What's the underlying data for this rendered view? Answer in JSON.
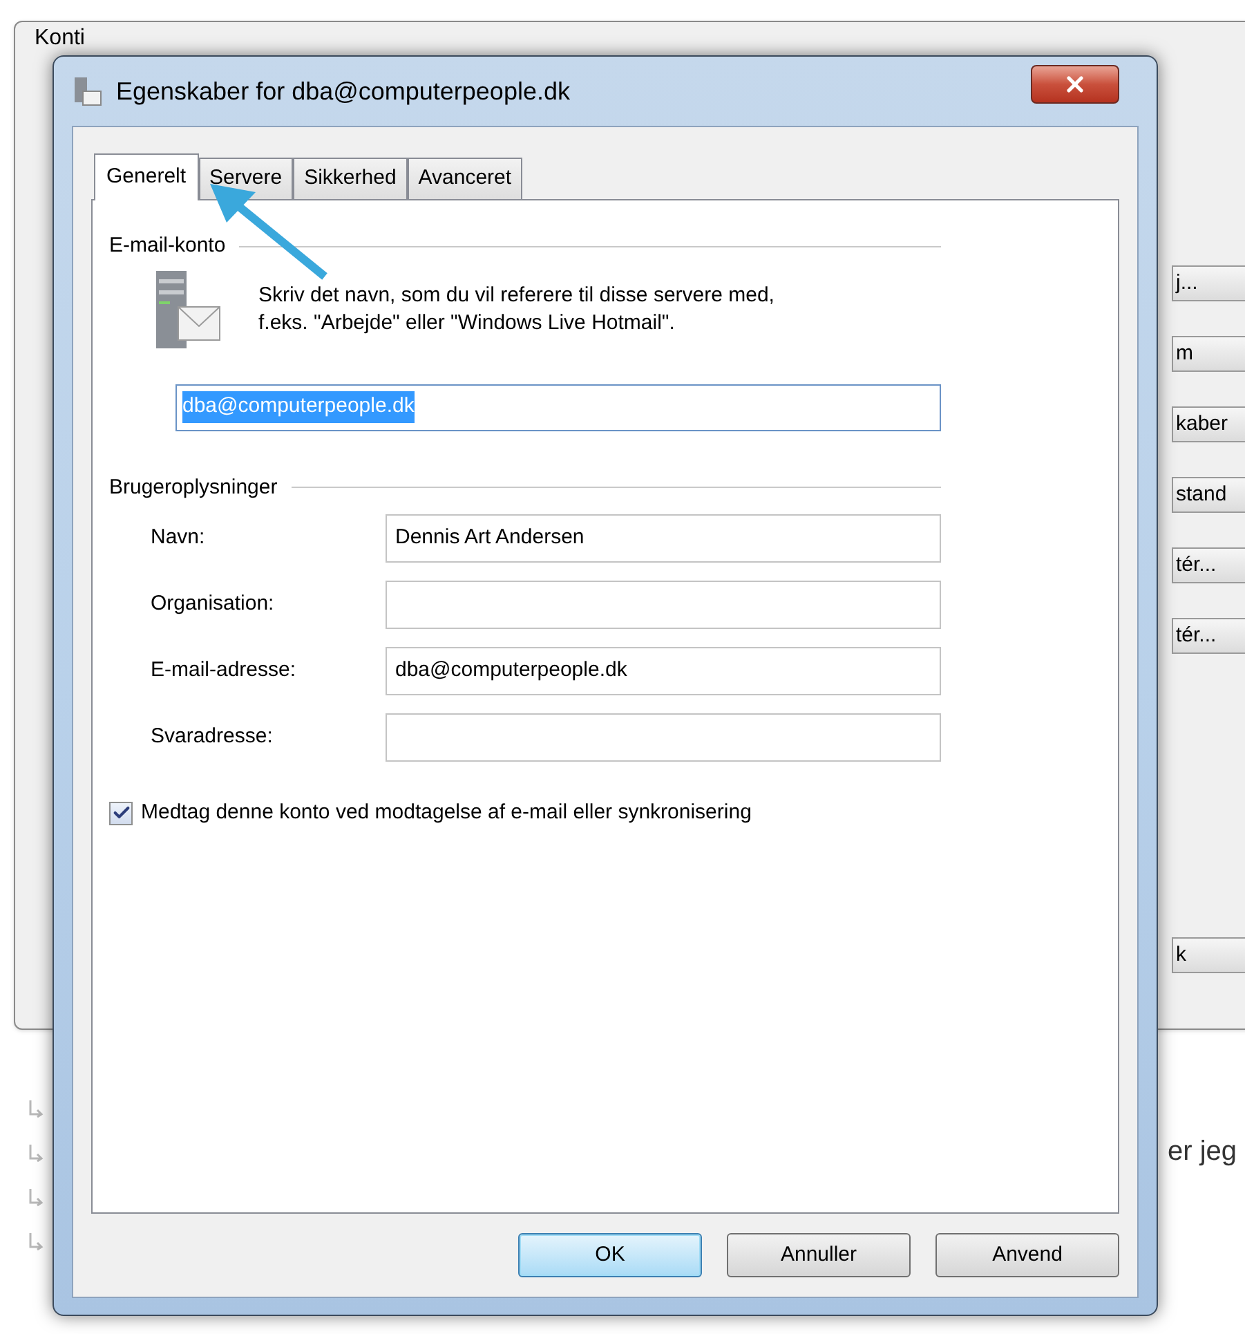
{
  "background_page": {
    "text": "er jeg"
  },
  "accounts_window": {
    "title": "Konti",
    "buttons": [
      "j...",
      "m",
      "kaber",
      "stand",
      "tér...",
      "tér...",
      "k"
    ]
  },
  "dialog": {
    "title": "Egenskaber for dba@computerpeople.dk",
    "tabs": [
      {
        "label": "Generelt",
        "selected": true
      },
      {
        "label": "Servere",
        "selected": false
      },
      {
        "label": "Sikkerhed",
        "selected": false
      },
      {
        "label": "Avanceret",
        "selected": false
      }
    ],
    "email_account": {
      "label": "E-mail-konto",
      "description": "Skriv det navn, som du vil referere til disse servere med,\nf.eks. \"Arbejde\" eller \"Windows Live Hotmail\".",
      "account_name": "dba@computerpeople.dk",
      "text_selected": true
    },
    "user_info": {
      "label": "Brugeroplysninger",
      "fields": [
        {
          "label": "Navn:",
          "value": "Dennis Art Andersen"
        },
        {
          "label": "Organisation:"
        },
        {
          "label": "E-mail-adresse:",
          "value": "dba@computerpeople.dk"
        },
        {
          "label": "Svaradresse:"
        }
      ]
    },
    "include_checkbox": {
      "label": "Medtag denne konto ved modtagelse af e-mail eller synkronisering",
      "checked": true
    },
    "buttons": [
      {
        "label": "OK",
        "default": true
      },
      {
        "label": "Annuller",
        "default": false
      },
      {
        "label": "Anvend",
        "default": false
      }
    ]
  }
}
